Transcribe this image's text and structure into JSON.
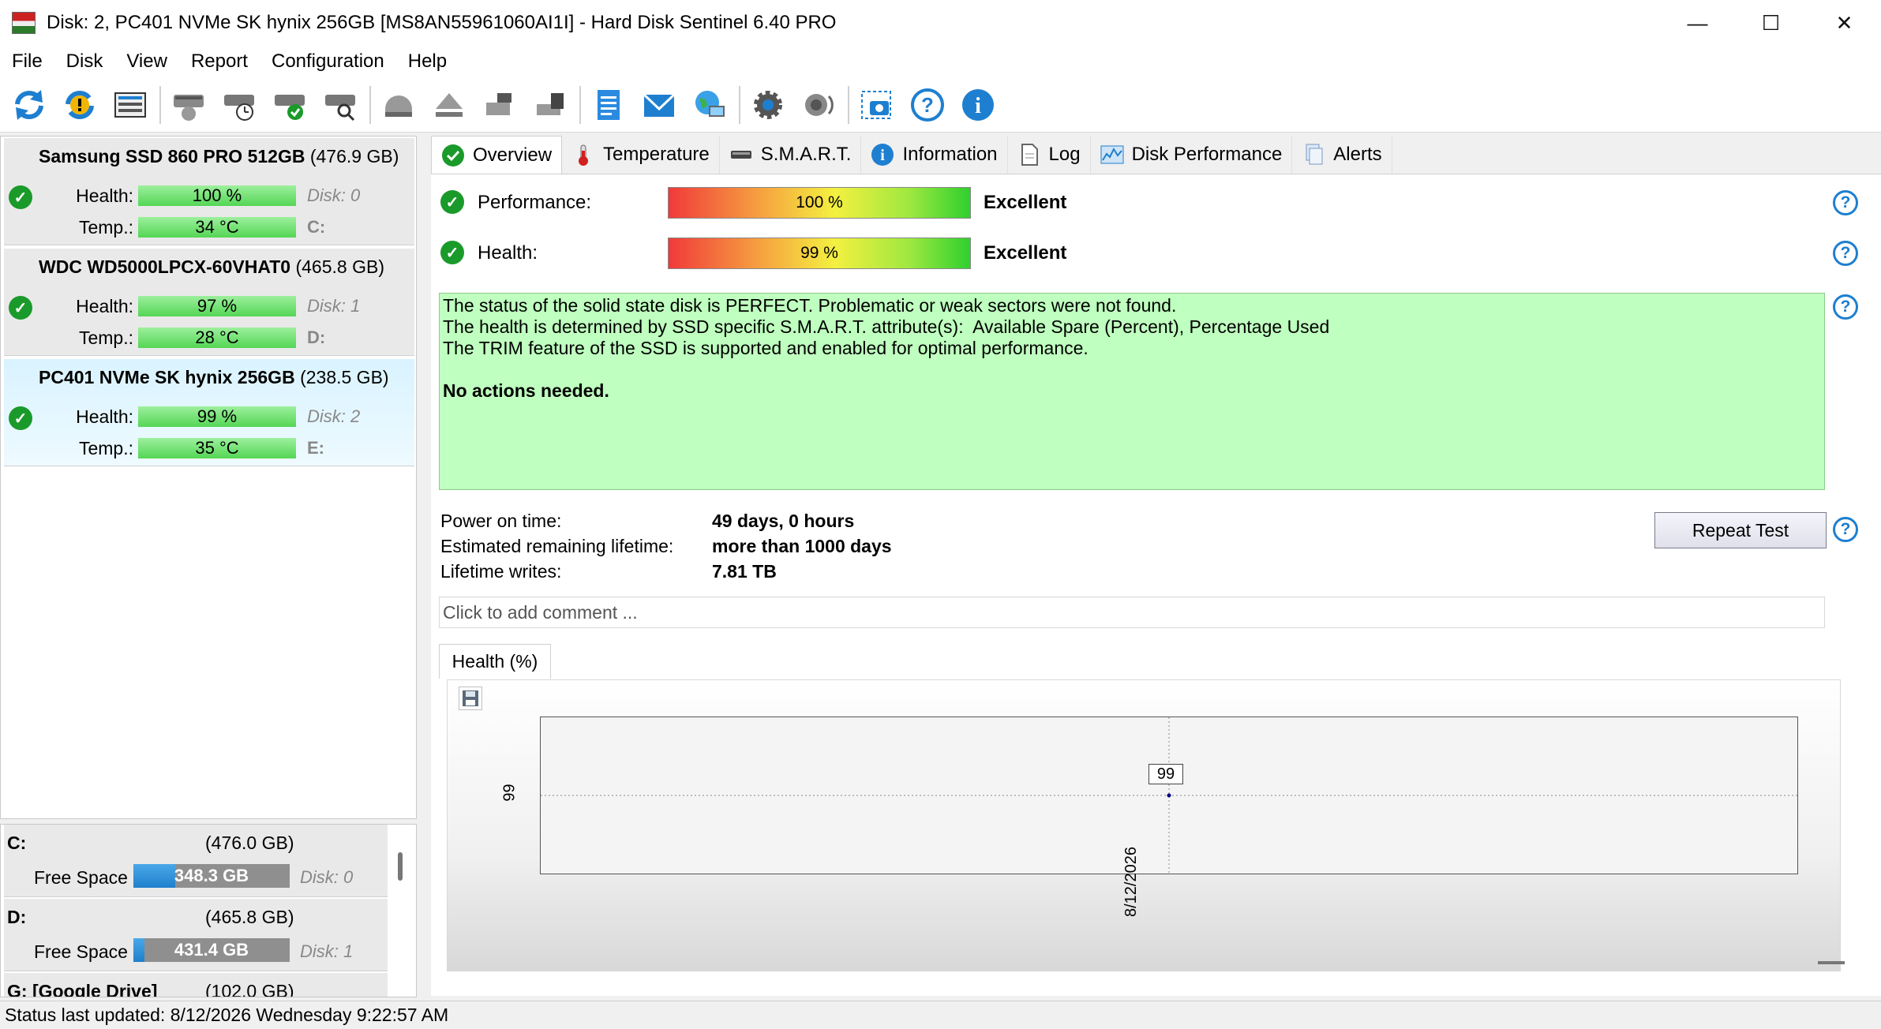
{
  "window": {
    "title": "Disk: 2, PC401 NVMe SK hynix 256GB [MS8AN55961060AI1I]  -  Hard Disk Sentinel 6.40 PRO",
    "minimize": "—",
    "maximize": "☐",
    "close": "✕"
  },
  "menu": [
    "File",
    "Disk",
    "View",
    "Report",
    "Configuration",
    "Help"
  ],
  "toolbar": {
    "icons": [
      "refresh-icon",
      "refresh-alert-icon",
      "disk-list-icon",
      "disk-spin-icon",
      "disk-schedule-icon",
      "disk-ok-icon",
      "disk-search-icon",
      "drive-gray-icon",
      "eject-icon",
      "drive-usb-icon",
      "drive-network-icon",
      "report-icon",
      "email-icon",
      "web-icon",
      "settings-icon",
      "sound-icon",
      "screenshot-icon",
      "help-icon",
      "info-icon"
    ]
  },
  "disks": [
    {
      "name": "Samsung SSD 860 PRO 512GB",
      "size": "(476.9 GB)",
      "health_label": "Health:",
      "health": "100 %",
      "disk_label": "Disk: 0",
      "temp_label": "Temp.:",
      "temp": "34 °C",
      "volume": "C:"
    },
    {
      "name": "WDC WD5000LPCX-60VHAT0",
      "size": "(465.8 GB)",
      "health_label": "Health:",
      "health": "97 %",
      "disk_label": "Disk: 1",
      "temp_label": "Temp.:",
      "temp": "28 °C",
      "volume": "D:"
    },
    {
      "name": "PC401 NVMe SK hynix 256GB",
      "size": "(238.5 GB)",
      "health_label": "Health:",
      "health": "99 %",
      "disk_label": "Disk: 2",
      "temp_label": "Temp.:",
      "temp": "35 °C",
      "volume": "E:"
    }
  ],
  "volumes": [
    {
      "letter": "C:",
      "size": "(476.0 GB)",
      "free_label": "Free Space",
      "free": "348.3 GB",
      "disk": "Disk: 0",
      "used_fraction": 0.27
    },
    {
      "letter": "D:",
      "size": "(465.8 GB)",
      "free_label": "Free Space",
      "free": "431.4 GB",
      "disk": "Disk: 1",
      "used_fraction": 0.07
    },
    {
      "letter": "G: [Google Drive]",
      "size": "(102.0 GB)"
    }
  ],
  "status_bar": "Status last updated: 8/12/2026 Wednesday 9:22:57 AM",
  "tabs": [
    "Overview",
    "Temperature",
    "S.M.A.R.T.",
    "Information",
    "Log",
    "Disk Performance",
    "Alerts"
  ],
  "overview": {
    "performance_label": "Performance:",
    "performance_value": "100 %",
    "performance_rating": "Excellent",
    "health_label": "Health:",
    "health_value": "99 %",
    "health_rating": "Excellent",
    "status_lines": [
      "The status of the solid state disk is PERFECT. Problematic or weak sectors were not found.",
      "The health is determined by SSD specific S.M.A.R.T. attribute(s):  Available Spare (Percent), Percentage Used",
      "The TRIM feature of the SSD is supported and enabled for optimal performance."
    ],
    "status_action": "No actions needed.",
    "power_on_label": "Power on time:",
    "power_on_value": "49 days, 0 hours",
    "remaining_label": "Estimated remaining lifetime:",
    "remaining_value": "more than 1000 days",
    "writes_label": "Lifetime writes:",
    "writes_value": "7.81 TB",
    "repeat_button": "Repeat Test",
    "comment_placeholder": "Click to add comment ..."
  },
  "chart_tab": "Health (%)",
  "chart_data": {
    "type": "line",
    "x": [
      "8/12/2026"
    ],
    "series": [
      {
        "values": [
          99
        ]
      }
    ],
    "ylabel": "",
    "xlabel": "",
    "y_tick_labels": [
      "99"
    ],
    "x_tick_labels": [
      "8/12/2026"
    ],
    "point_labels": [
      "99"
    ],
    "grid": true
  },
  "help_glyph": "?"
}
